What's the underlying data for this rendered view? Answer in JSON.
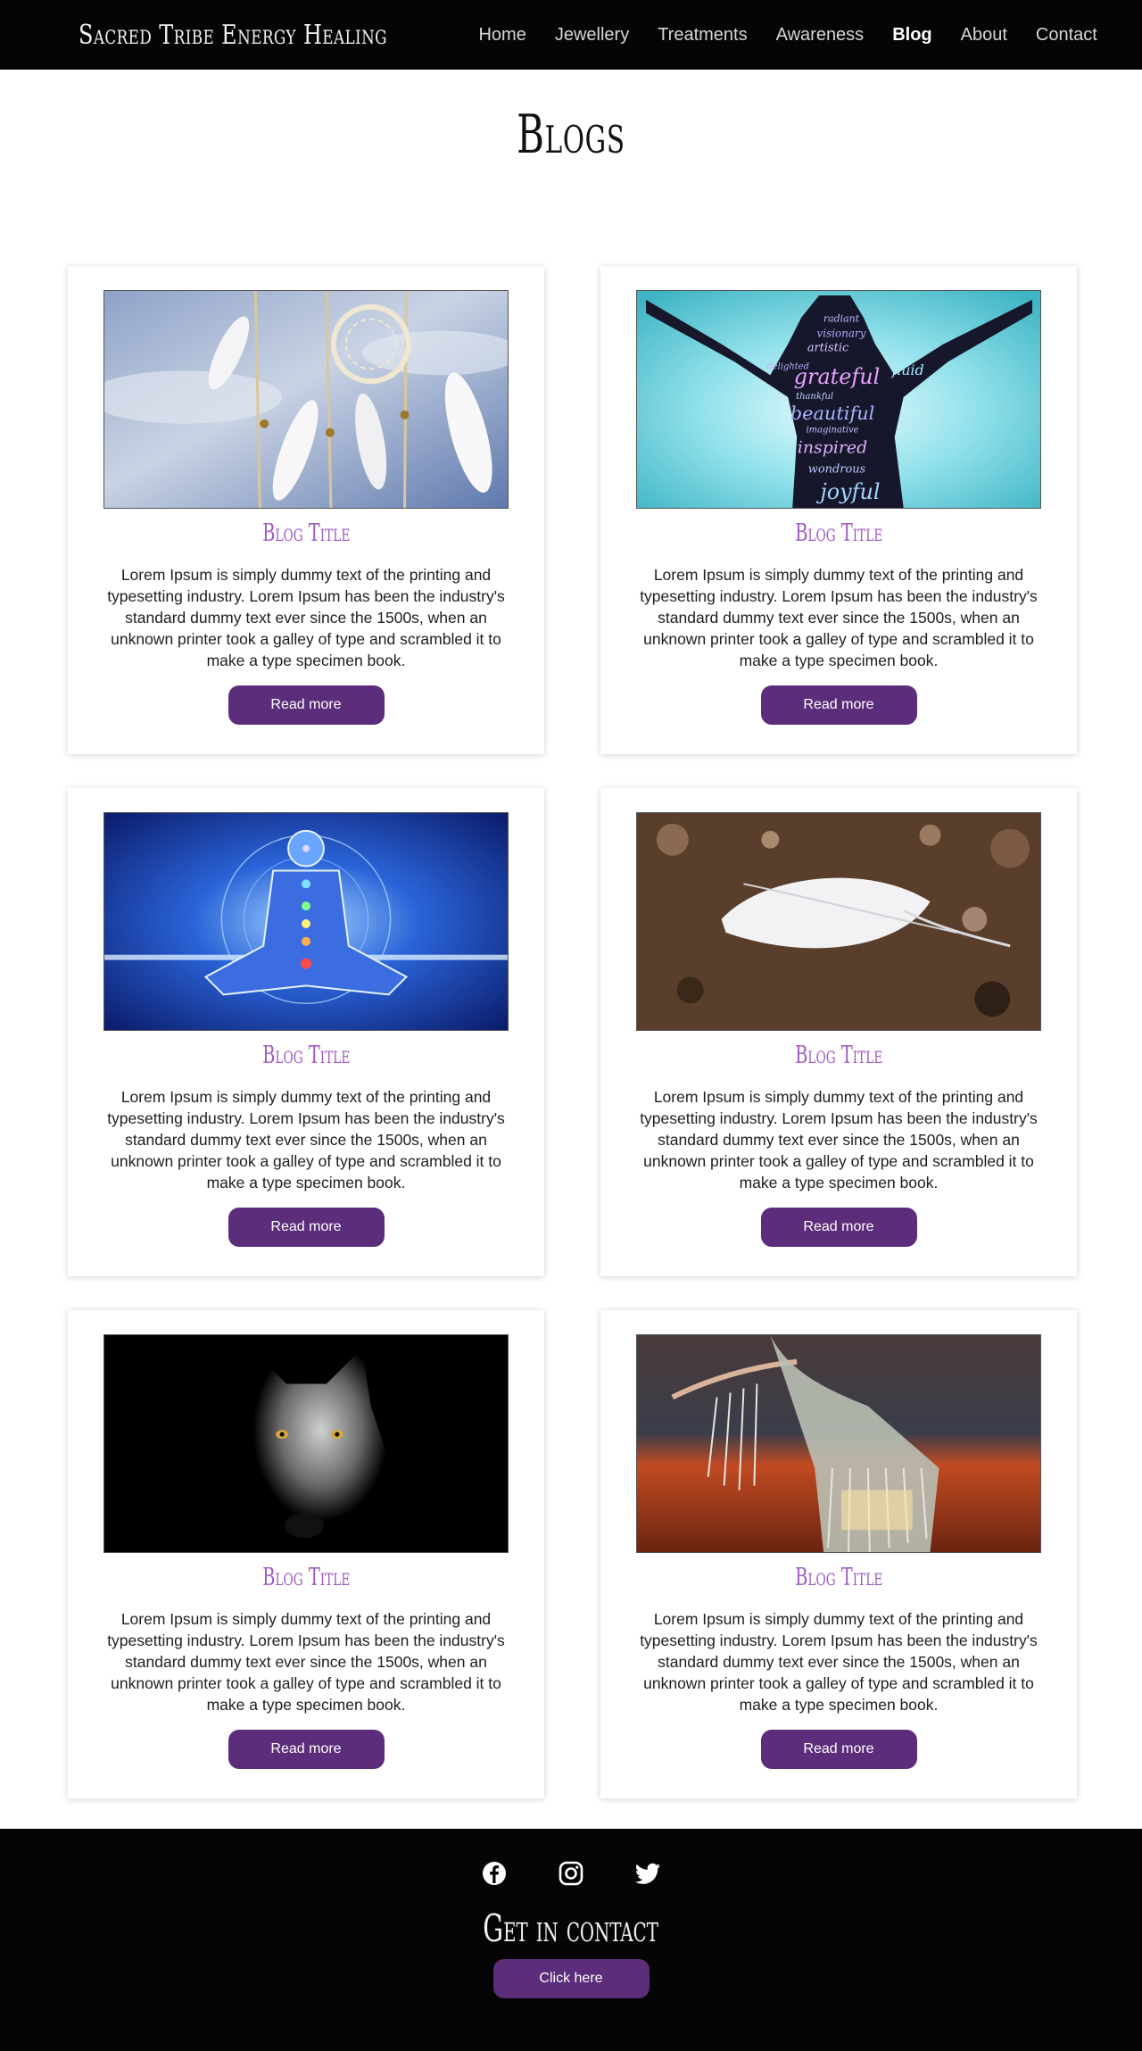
{
  "nav": {
    "brand": "Sacred Tribe Energy Healing",
    "links": [
      "Home",
      "Jewellery",
      "Treatments",
      "Awareness",
      "Blog",
      "About",
      "Contact"
    ],
    "active": "Blog"
  },
  "page": {
    "title": "Blogs"
  },
  "posts": [
    {
      "title": "Blog Title",
      "image": "dreamcatcher-feathers-image",
      "text": "Lorem Ipsum is simply dummy text of the printing and typesetting industry. Lorem Ipsum has been the industry's standard dummy text ever since the 1500s, when an unknown printer took a galley of type and scrambled it to make a type specimen book.",
      "button": "Read more"
    },
    {
      "title": "Blog Title",
      "image": "word-cloud-silhouette-image",
      "text": "Lorem Ipsum is simply dummy text of the printing and typesetting industry. Lorem Ipsum has been the industry's standard dummy text ever since the 1500s, when an unknown printer took a galley of type and scrambled it to make a type specimen book.",
      "button": "Read more",
      "image_words": [
        "grateful",
        "beautiful",
        "inspired",
        "joyful",
        "radiant",
        "visionary",
        "artistic",
        "fluid",
        "delighted",
        "thankful",
        "imaginative",
        "wondrous"
      ]
    },
    {
      "title": "Blog Title",
      "image": "meditation-chakras-image",
      "text": "Lorem Ipsum is simply dummy text of the printing and typesetting industry. Lorem Ipsum has been the industry's standard dummy text ever since the 1500s, when an unknown printer took a galley of type and scrambled it to make a type specimen book.",
      "button": "Read more"
    },
    {
      "title": "Blog Title",
      "image": "white-feather-image",
      "text": "Lorem Ipsum is simply dummy text of the printing and typesetting industry. Lorem Ipsum has been the industry's standard dummy text ever since the 1500s, when an unknown printer took a galley of type and scrambled it to make a type specimen book.",
      "button": "Read more"
    },
    {
      "title": "Blog Title",
      "image": "wolf-image",
      "text": "Lorem Ipsum is simply dummy text of the printing and typesetting industry. Lorem Ipsum has been the industry's standard dummy text ever since the 1500s, when an unknown printer took a galley of type and scrambled it to make a type specimen book.",
      "button": "Read more"
    },
    {
      "title": "Blog Title",
      "image": "fringed-dress-dancer-image",
      "text": "Lorem Ipsum is simply dummy text of the printing and typesetting industry. Lorem Ipsum has been the industry's standard dummy text ever since the 1500s, when an unknown printer took a galley of type and scrambled it to make a type specimen book.",
      "button": "Read more"
    }
  ],
  "footer": {
    "socials": [
      "facebook-icon",
      "instagram-icon",
      "twitter-icon"
    ],
    "heading": "Get in contact",
    "button": "Click here"
  },
  "colors": {
    "accent": "#5c2d7a",
    "title": "#a05cc0",
    "nav_bg": "#050505"
  }
}
